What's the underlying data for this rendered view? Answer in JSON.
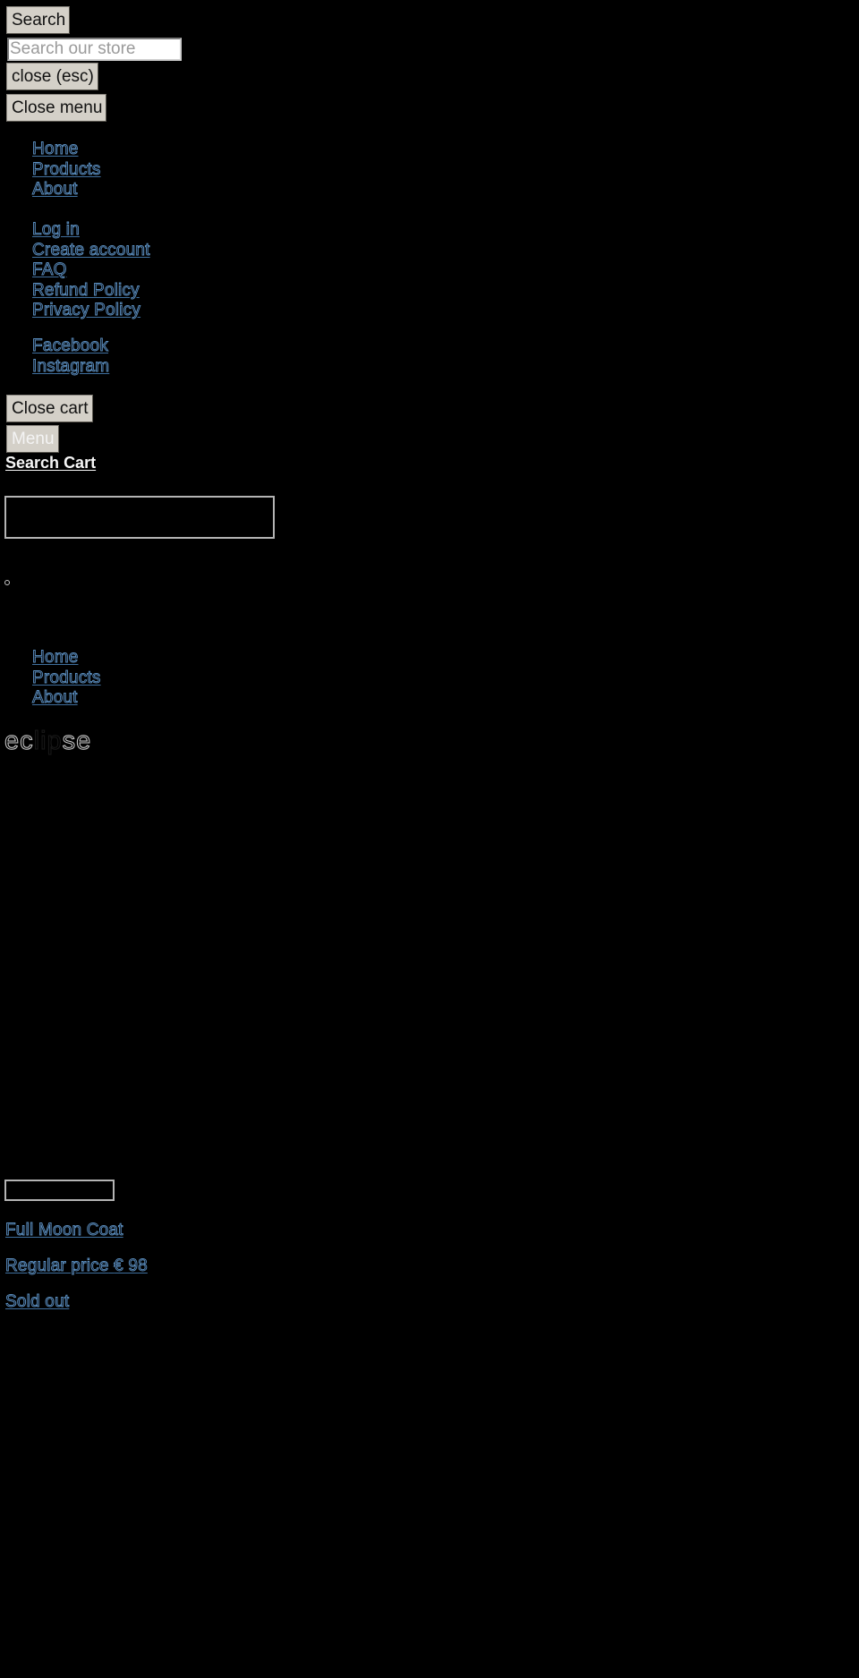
{
  "search_drawer": {
    "search_button_label": "Search",
    "search_placeholder": "Search our store",
    "search_value": "",
    "close_button_label": "close (esc)"
  },
  "menu_drawer": {
    "close_button_label": "Close menu",
    "main_nav": [
      {
        "label": "Home"
      },
      {
        "label": "Products"
      },
      {
        "label": "About"
      }
    ],
    "secondary_nav": [
      {
        "label": "Log in"
      },
      {
        "label": "Create account"
      },
      {
        "label": "FAQ"
      },
      {
        "label": "Refund Policy"
      },
      {
        "label": "Privacy Policy"
      }
    ],
    "social_nav": [
      {
        "label": "Facebook"
      },
      {
        "label": "Instagram"
      }
    ]
  },
  "cart_drawer": {
    "close_button_label": "Close cart"
  },
  "header": {
    "menu_button_label": "Menu",
    "search_link_label": "Search",
    "cart_link_label": "Cart",
    "nav": [
      {
        "label": "Home"
      },
      {
        "label": "Products"
      },
      {
        "label": "About"
      }
    ],
    "logo_text": {
      "part1": "ec",
      "part2": "li",
      "part3": "p",
      "part4": "se"
    }
  },
  "product": {
    "title": "Full Moon Coat",
    "price_label": "Regular price",
    "price": "€ 98",
    "status": "Sold out"
  },
  "colors": {
    "background": "#000000",
    "link_outline": "#5b8fc0",
    "button_bg": "#d4d0c8"
  }
}
